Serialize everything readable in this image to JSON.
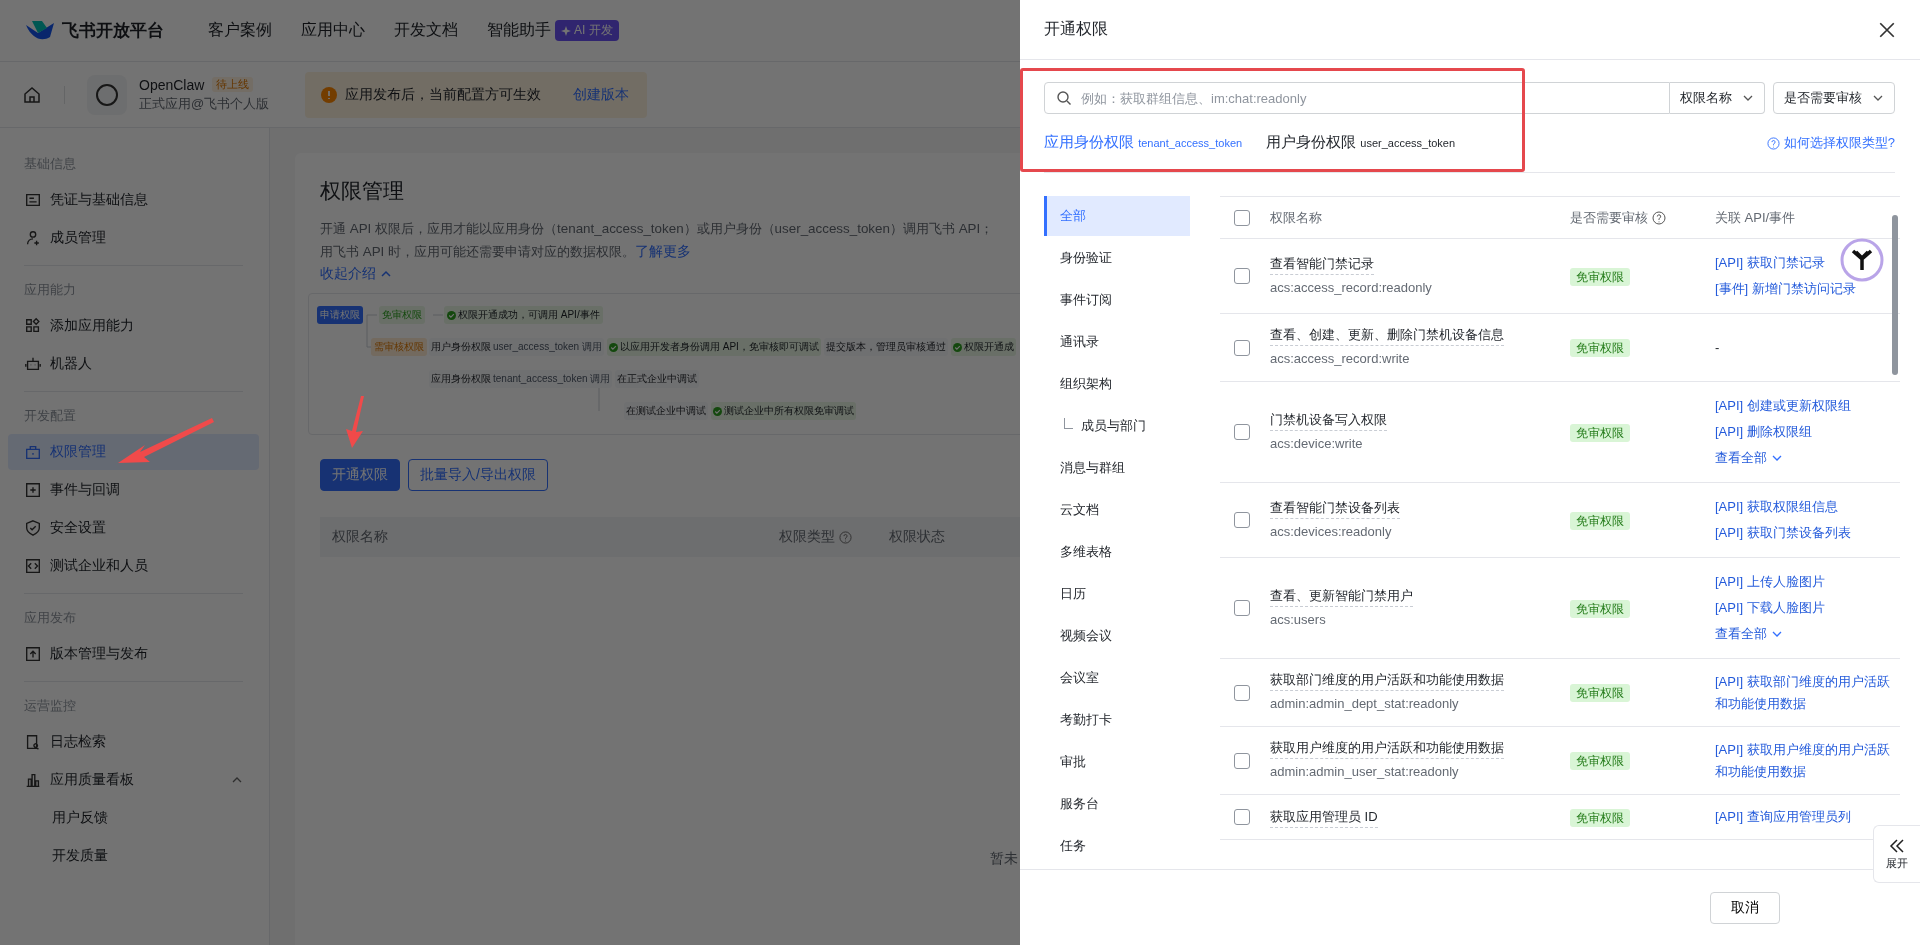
{
  "topnav": {
    "brand": "飞书开放平台",
    "links": [
      "客户案例",
      "应用中心",
      "开发文档",
      "智能助手"
    ],
    "ai_badge": "AI 开发"
  },
  "app_bar": {
    "app_name": "OpenClaw",
    "status_badge": "待上线",
    "app_type": "正式应用@飞书个人版",
    "notice": "应用发布后，当前配置方可生效",
    "notice_action": "创建版本"
  },
  "sidebar": {
    "sections": [
      {
        "title": "基础信息",
        "items": [
          {
            "label": "凭证与基础信息",
            "selected": false
          },
          {
            "label": "成员管理",
            "selected": false
          }
        ]
      },
      {
        "title": "应用能力",
        "items": [
          {
            "label": "添加应用能力",
            "selected": false
          },
          {
            "label": "机器人",
            "selected": false
          }
        ]
      },
      {
        "title": "开发配置",
        "items": [
          {
            "label": "权限管理",
            "selected": true
          },
          {
            "label": "事件与回调",
            "selected": false
          },
          {
            "label": "安全设置",
            "selected": false
          },
          {
            "label": "测试企业和人员",
            "selected": false
          }
        ]
      },
      {
        "title": "应用发布",
        "items": [
          {
            "label": "版本管理与发布",
            "selected": false
          }
        ]
      },
      {
        "title": "运营监控",
        "items": [
          {
            "label": "日志检索",
            "selected": false
          },
          {
            "label": "应用质量看板",
            "selected": false,
            "expanded": true,
            "children": [
              {
                "label": "用户反馈",
                "selected": false
              },
              {
                "label": "开发质量",
                "selected": false
              }
            ]
          }
        ]
      }
    ]
  },
  "main": {
    "title": "权限管理",
    "description_lines": [
      "开通 API 权限后，应用才能以应用身份（tenant_access_token）或用户身份（user_access_token）调用飞书 API；",
      "用飞书 API 时，应用可能还需要申请对应的数据权限。"
    ],
    "learn_more": "了解更多",
    "collapse": "收起介绍",
    "diagram": {
      "start": "申请权限",
      "free": "免审权限",
      "free_result": "权限开通成功，可调用 API/事件",
      "review": "需审核权限",
      "user_identity": "用户身份权限",
      "user_token": "user_access_token 调用",
      "user_result": "以应用开发者身份调用 API，免审核即可调试",
      "submit": "提交版本，管理员审核通过",
      "final": "权限开通成",
      "app_identity": "应用身份权限",
      "app_token": "tenant_access_token 调用",
      "prod_debug": "在正式企业中调试",
      "test_debug": "在测试企业中调试",
      "test_result": "测试企业中所有权限免审调试"
    },
    "buttons": [
      {
        "label": "开通权限",
        "primary": true
      },
      {
        "label": "批量导入/导出权限",
        "primary": false
      }
    ],
    "table": {
      "columns": [
        {
          "label": "权限名称",
          "help": false
        },
        {
          "label": "权限类型",
          "help": true
        },
        {
          "label": "权限状态",
          "help": false
        }
      ],
      "empty_text": "暂未"
    }
  },
  "drawer": {
    "title": "开通权限",
    "search": {
      "placeholder": "例如：获取群组信息、im:chat:readonly"
    },
    "filters": [
      "权限名称",
      "是否需要审核"
    ],
    "tabs": [
      {
        "label": "应用身份权限",
        "token": "tenant_access_token",
        "selected": true
      },
      {
        "label": "用户身份权限",
        "token": "user_access_token",
        "selected": false
      }
    ],
    "help_link": "如何选择权限类型?",
    "categories": [
      {
        "label": "全部",
        "selected": true
      },
      {
        "label": "身份验证",
        "selected": false
      },
      {
        "label": "事件订阅",
        "selected": false
      },
      {
        "label": "通讯录",
        "selected": false
      },
      {
        "label": "组织架构",
        "selected": false,
        "children": [
          {
            "label": "成员与部门",
            "selected": false
          }
        ]
      },
      {
        "label": "消息与群组",
        "selected": false
      },
      {
        "label": "云文档",
        "selected": false
      },
      {
        "label": "多维表格",
        "selected": false
      },
      {
        "label": "日历",
        "selected": false
      },
      {
        "label": "视频会议",
        "selected": false
      },
      {
        "label": "会议室",
        "selected": false
      },
      {
        "label": "考勤打卡",
        "selected": false
      },
      {
        "label": "审批",
        "selected": false
      },
      {
        "label": "服务台",
        "selected": false
      },
      {
        "label": "任务",
        "selected": false
      }
    ],
    "table": {
      "select_all_checked": false,
      "columns": [
        {
          "label": "权限名称",
          "help": false
        },
        {
          "label": "是否需要审核",
          "help": true
        },
        {
          "label": "关联 API/事件",
          "help": false
        }
      ],
      "rows": [
        {
          "checked": false,
          "name": "查看智能门禁记录",
          "scope": "acs:access_record:readonly",
          "review": "免审权限",
          "apis": [
            "[API] 获取门禁记录",
            "[事件] 新增门禁访问记录"
          ]
        },
        {
          "checked": false,
          "name": "查看、创建、更新、删除门禁机设备信息",
          "scope": "acs:access_record:write",
          "review": "免审权限",
          "no_apis": "-"
        },
        {
          "checked": false,
          "name": "门禁机设备写入权限",
          "scope": "acs:device:write",
          "review": "免审权限",
          "apis": [
            "[API] 创建或更新权限组",
            "[API] 删除权限组"
          ],
          "more": "查看全部"
        },
        {
          "checked": false,
          "name": "查看智能门禁设备列表",
          "scope": "acs:devices:readonly",
          "review": "免审权限",
          "apis": [
            "[API] 获取权限组信息",
            "[API] 获取门禁设备列表"
          ]
        },
        {
          "checked": false,
          "name": "查看、更新智能门禁用户",
          "scope": "acs:users",
          "review": "免审权限",
          "apis": [
            "[API] 上传人脸图片",
            "[API] 下载人脸图片"
          ],
          "more": "查看全部"
        },
        {
          "checked": false,
          "name": "获取部门维度的用户活跃和功能使用数据",
          "scope": "admin:admin_dept_stat:readonly",
          "review": "免审权限",
          "apis": [
            "[API] 获取部门维度的用户活跃和功能使用数据"
          ]
        },
        {
          "checked": false,
          "name": "获取用户维度的用户活跃和功能使用数据",
          "scope": "admin:admin_user_stat:readonly",
          "review": "免审权限",
          "apis": [
            "[API] 获取用户维度的用户活跃和功能使用数据"
          ]
        },
        {
          "checked": false,
          "name": "获取应用管理员 ID",
          "review": "免审权限",
          "apis": [
            "[API] 查询应用管理员列"
          ]
        }
      ]
    },
    "footer_button": "取消",
    "expand_tab": "展开"
  }
}
